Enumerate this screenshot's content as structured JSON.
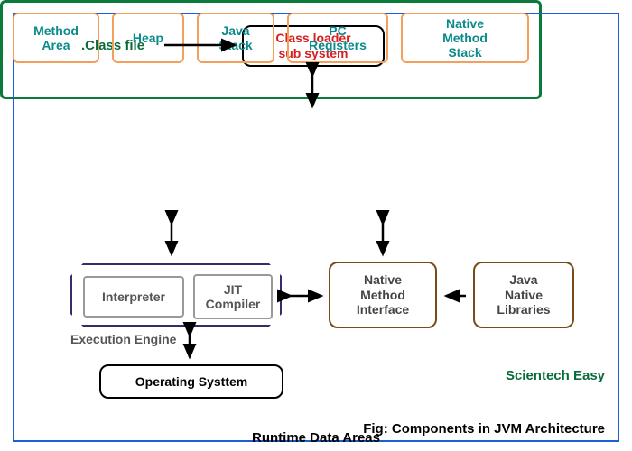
{
  "title_label": ".Class file",
  "classloader": {
    "l1": "Class loader",
    "l2": "sub system"
  },
  "rda": {
    "label": "Runtime Data Areas",
    "items": [
      {
        "l1": "Method",
        "l2": "Area"
      },
      {
        "l1": "Heap",
        "l2": ""
      },
      {
        "l1": "Java",
        "l2": "Stack"
      },
      {
        "l1": "PC",
        "l2": "Registers"
      },
      {
        "l1": "Native",
        "l2": "Method",
        "l3": "Stack"
      }
    ]
  },
  "exec": {
    "label": "Execution Engine",
    "interpreter": "Interpreter",
    "jit": {
      "l1": "JIT",
      "l2": "Compiler"
    }
  },
  "nmi": {
    "l1": "Native",
    "l2": "Method",
    "l3": "Interface"
  },
  "jnl": {
    "l1": "Java",
    "l2": "Native",
    "l3": "Libraries"
  },
  "os": "Operating Systtem",
  "brand": "Scientech Easy",
  "caption": "Fig: Components in JVM Architecture"
}
